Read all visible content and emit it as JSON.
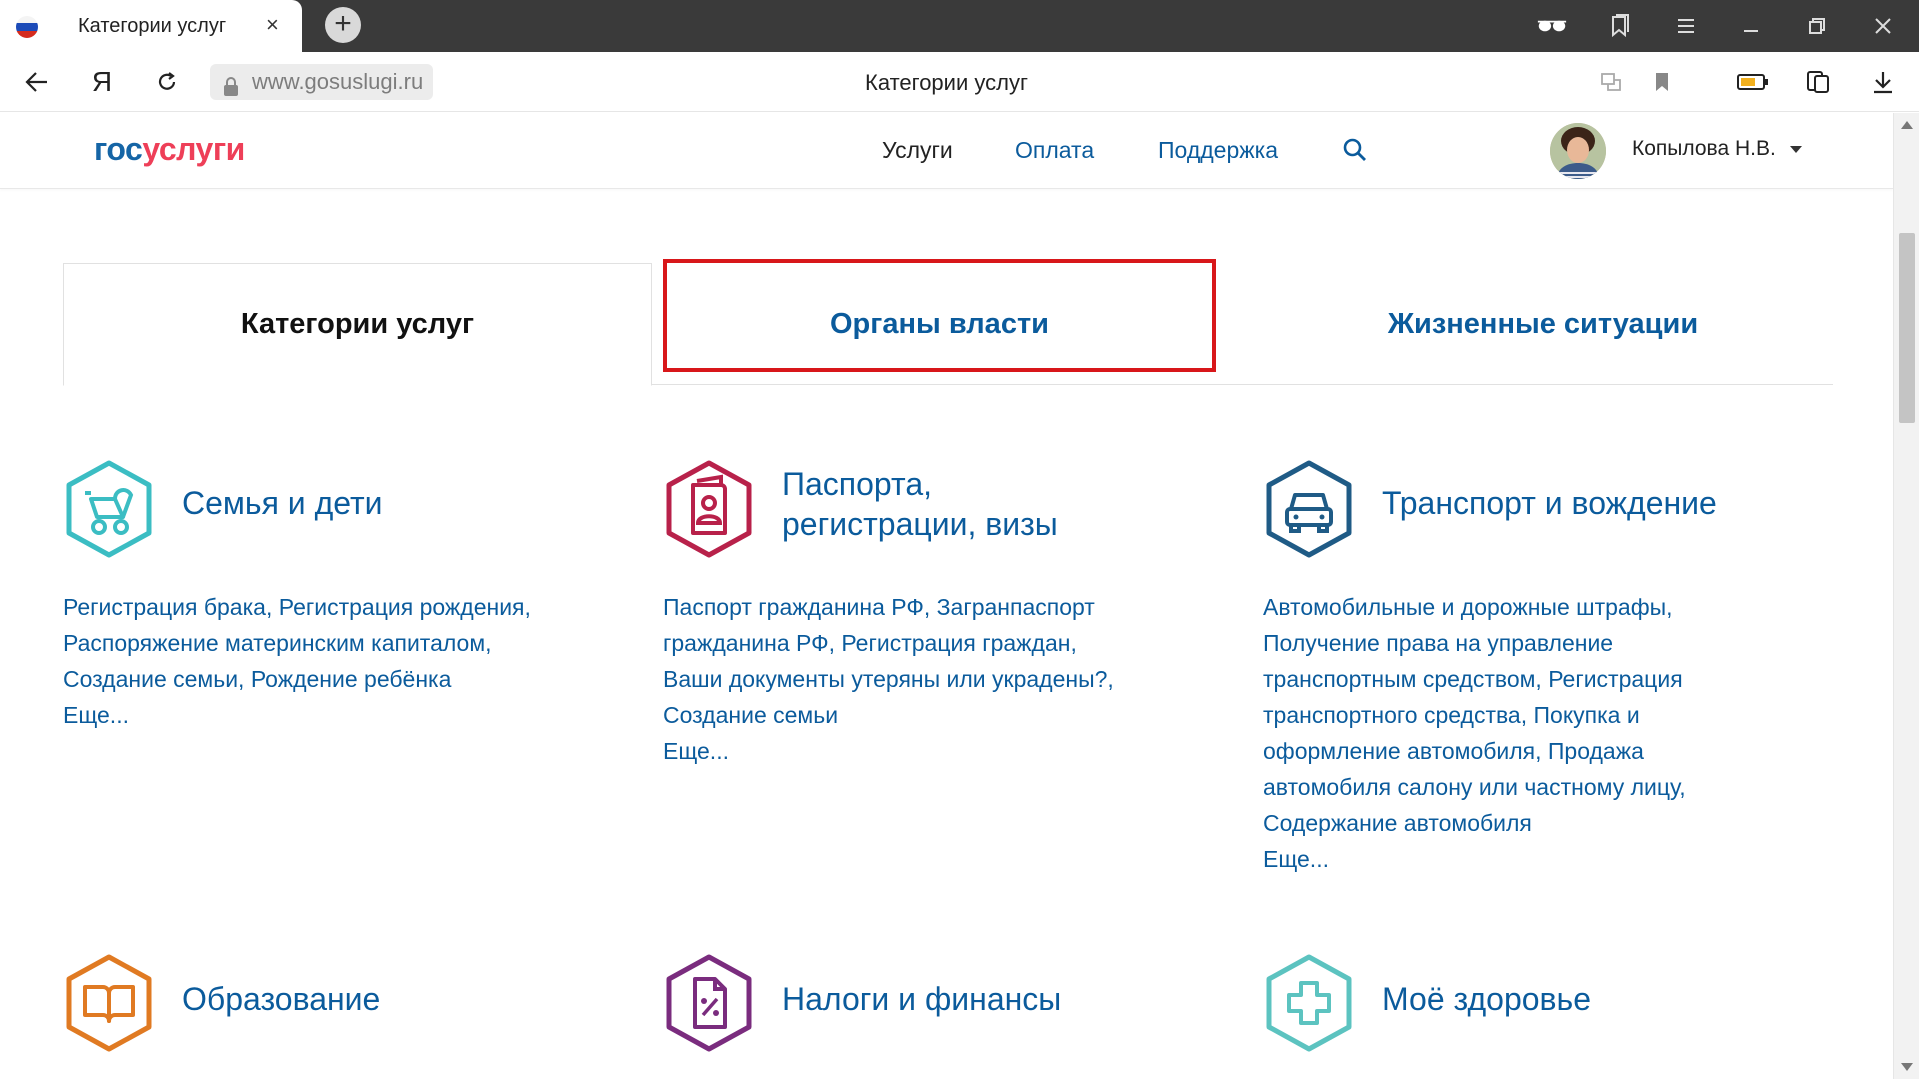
{
  "browser": {
    "tab_title": "Категории услуг",
    "tab_close": "×",
    "new_tab": "+",
    "url": "www.gosuslugi.ru",
    "page_title": "Категории услуг",
    "address_letter": "Я"
  },
  "header": {
    "logo_gos": "гос",
    "logo_usl": "услуги",
    "menu": [
      "Услуги",
      "Оплата",
      "Поддержка"
    ],
    "user_name": "Копылова Н.В."
  },
  "tabs": [
    "Категории услуг",
    "Органы власти",
    "Жизненные ситуации"
  ],
  "categories": [
    {
      "title": "Семья и дети",
      "links": "Регистрация брака, Регистрация рождения,\nРаспоряжение материнским капиталом,\nСоздание семьи, Рождение ребёнка",
      "more": "Еще..."
    },
    {
      "title": "Паспорта,\nрегистрации, визы",
      "links": "Паспорт гражданина РФ, Загранпаспорт\nгражданина РФ, Регистрация граждан,\nВаши документы утеряны или украдены?,\nСоздание семьи",
      "more": "Еще..."
    },
    {
      "title": "Транспорт и вождение",
      "links": "Автомобильные и дорожные штрафы,\nПолучение права на управление\nтранспортным средством, Регистрация\nтранспортного средства, Покупка и\nоформление автомобиля, Продажа\nавтомобиля салону или частному лицу,\nСодержание автомобиля",
      "more": "Еще..."
    },
    {
      "title": "Образование"
    },
    {
      "title": "Налоги и финансы"
    },
    {
      "title": "Моё здоровье"
    }
  ],
  "colors": {
    "link": "#0b5b9c",
    "highlight_border": "#d8171a",
    "family_icon": "#3bbdc3",
    "passport_icon": "#b8214a",
    "transport_icon": "#1f5b86",
    "education_icon": "#e07a22",
    "tax_icon": "#7a2c7e",
    "health_icon": "#5cc3c0"
  }
}
